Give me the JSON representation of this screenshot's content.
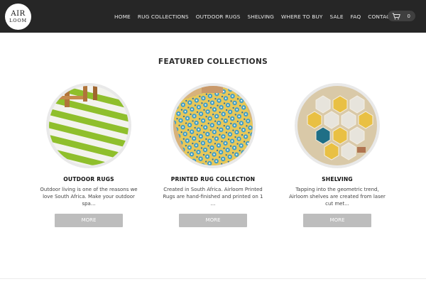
{
  "brand": {
    "logo_line1": "AIR",
    "logo_line2": "LOOM"
  },
  "nav": {
    "items": [
      "HOME",
      "RUG COLLECTIONS",
      "OUTDOOR RUGS",
      "SHELVING",
      "WHERE TO BUY",
      "SALE",
      "FAQ",
      "CONTACT US"
    ],
    "cart_icon": "cart-icon",
    "cart_count": "0"
  },
  "main": {
    "section_title": "FEATURED COLLECTIONS",
    "collections": [
      {
        "title": "OUTDOOR RUGS",
        "description": "Outdoor living is one of the reasons we love South Africa. Make your outdoor spa...",
        "button": "MORE"
      },
      {
        "title": "PRINTED RUG COLLECTION",
        "description": "Created in South Africa. Airloom Printed Rugs are hand-finished and printed on 1 ...",
        "button": "MORE"
      },
      {
        "title": "SHELVING",
        "description": "Tapping into the geometric trend, Airloom shelves are created from laser cut met...",
        "button": "MORE"
      }
    ]
  },
  "colors": {
    "header_bg": "#262626",
    "button_bg": "#bdbdbd"
  }
}
